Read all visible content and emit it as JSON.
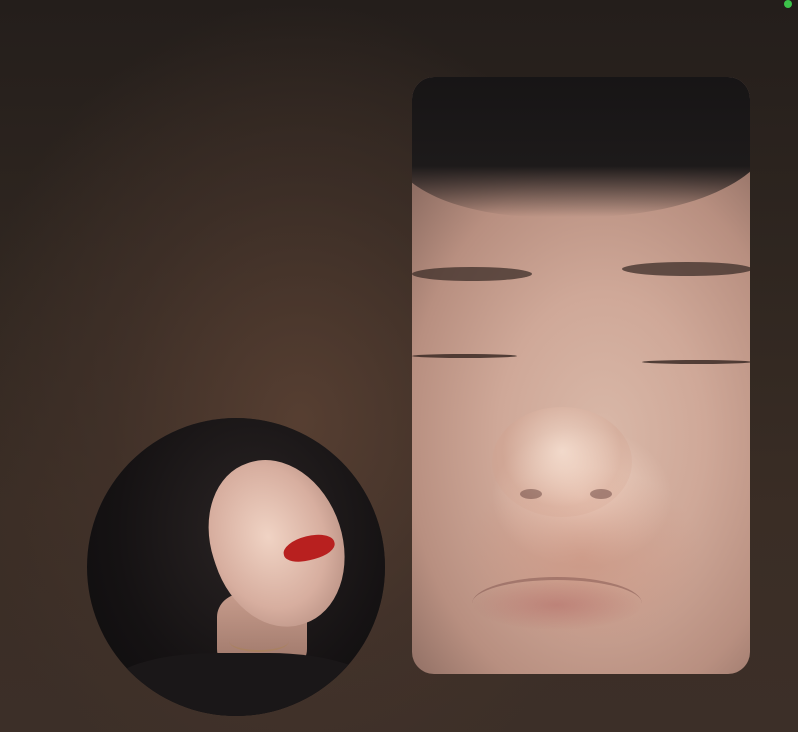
{
  "call": {
    "status_color": "#3cc24a",
    "remote_participant": {
      "view": "remote-video",
      "shape": "rounded-rectangle"
    },
    "self_view": {
      "view": "self-video",
      "shape": "circle"
    }
  }
}
